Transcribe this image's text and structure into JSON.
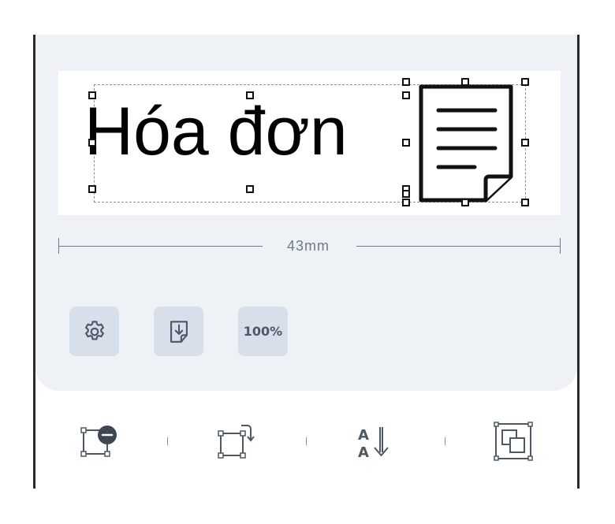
{
  "canvas": {
    "label_text": "Hóa đơn",
    "dimension_label": "43mm"
  },
  "toolbar": {
    "settings_icon": "gear-icon",
    "import_icon": "download-document-icon",
    "zoom_label": "100%"
  },
  "bottom_bar": {
    "items": [
      {
        "icon": "remove-element-icon"
      },
      {
        "icon": "rotate-element-icon"
      },
      {
        "icon": "text-direction-icon"
      },
      {
        "icon": "layer-arrange-icon"
      }
    ]
  },
  "colors": {
    "panel_bg": "#eef1f6",
    "button_bg": "#d7e0ea",
    "dimension_line": "#6e7a88",
    "frame_border": "#2b2b2b"
  }
}
